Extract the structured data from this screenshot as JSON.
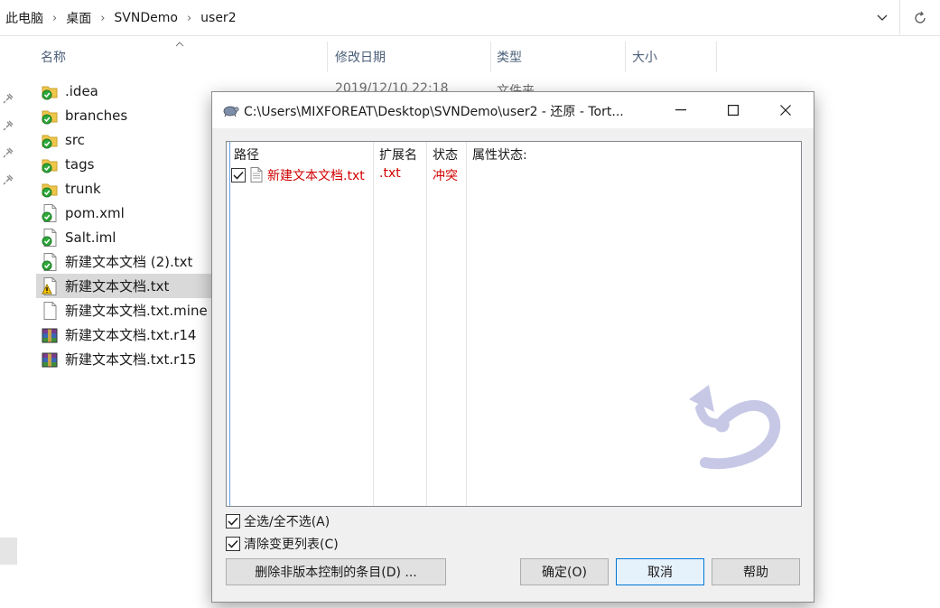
{
  "explorer": {
    "breadcrumb": [
      "此电脑",
      "桌面",
      "SVNDemo",
      "user2"
    ],
    "columns": {
      "name": "名称",
      "modified": "修改日期",
      "type": "类型",
      "size": "大小"
    },
    "first_row_date": "2019/12/10 22:18",
    "first_row_type": "文件夹",
    "files": [
      {
        "name": ".idea",
        "icon": "svn-folder-normal-icon"
      },
      {
        "name": "branches",
        "icon": "svn-folder-normal-icon"
      },
      {
        "name": "src",
        "icon": "svn-folder-normal-icon"
      },
      {
        "name": "tags",
        "icon": "svn-folder-normal-icon"
      },
      {
        "name": "trunk",
        "icon": "svn-folder-normal-icon"
      },
      {
        "name": "pom.xml",
        "icon": "svn-file-normal-icon"
      },
      {
        "name": "Salt.iml",
        "icon": "svn-file-normal-icon"
      },
      {
        "name": "新建文本文档 (2).txt",
        "icon": "svn-file-normal-icon"
      },
      {
        "name": "新建文本文档.txt",
        "icon": "svn-file-conflict-icon",
        "selected": true
      },
      {
        "name": "新建文本文档.txt.mine",
        "icon": "blank-file-icon"
      },
      {
        "name": "新建文本文档.txt.r14",
        "icon": "winrar-archive-icon"
      },
      {
        "name": "新建文本文档.txt.r15",
        "icon": "winrar-archive-icon"
      }
    ]
  },
  "dialog": {
    "title": "C:\\Users\\MIXFOREAT\\Desktop\\SVNDemo\\user2 - 还原 - Tort...",
    "list_headers": {
      "path": "路径",
      "ext": "扩展名",
      "status": "状态",
      "props": "属性状态:"
    },
    "rows": [
      {
        "checked": true,
        "path": "新建文本文档.txt",
        "ext": ".txt",
        "status": "冲突",
        "color": "#d10000"
      }
    ],
    "select_all_label": "全选/全不选(A)",
    "select_all_checked": true,
    "clear_changelist_label": "清除变更列表(C)",
    "clear_changelist_checked": true,
    "buttons": {
      "delete_unversioned": "删除非版本控制的条目(D) ...",
      "ok": "确定(O)",
      "cancel": "取消",
      "help": "帮助"
    }
  }
}
